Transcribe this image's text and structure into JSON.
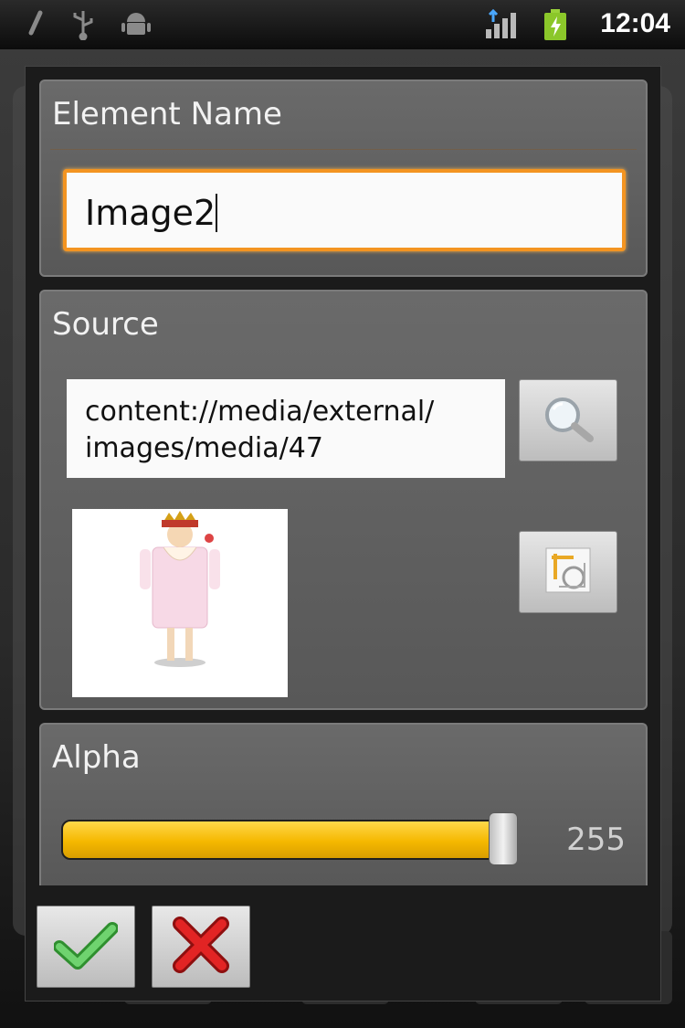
{
  "status_bar": {
    "time": "12:04",
    "icons": [
      "usb-debug-icon",
      "usb-icon",
      "android-icon",
      "signal-icon",
      "battery-charging-icon"
    ]
  },
  "dialog": {
    "element_name": {
      "title": "Element Name",
      "value": "Image2"
    },
    "source": {
      "title": "Source",
      "path_line1": "content://media/external/",
      "path_line2": "images/media/47",
      "search_button_icon": "magnifier-icon",
      "crop_button_icon": "crop-icon"
    },
    "alpha": {
      "title": "Alpha",
      "value": "255",
      "fraction": 1.0
    },
    "actions": {
      "ok_icon": "checkmark-icon",
      "cancel_icon": "x-icon"
    }
  },
  "colors": {
    "focus_border": "#f39421",
    "slider_fill": "#f5b800",
    "panel_bg": "#616161"
  }
}
